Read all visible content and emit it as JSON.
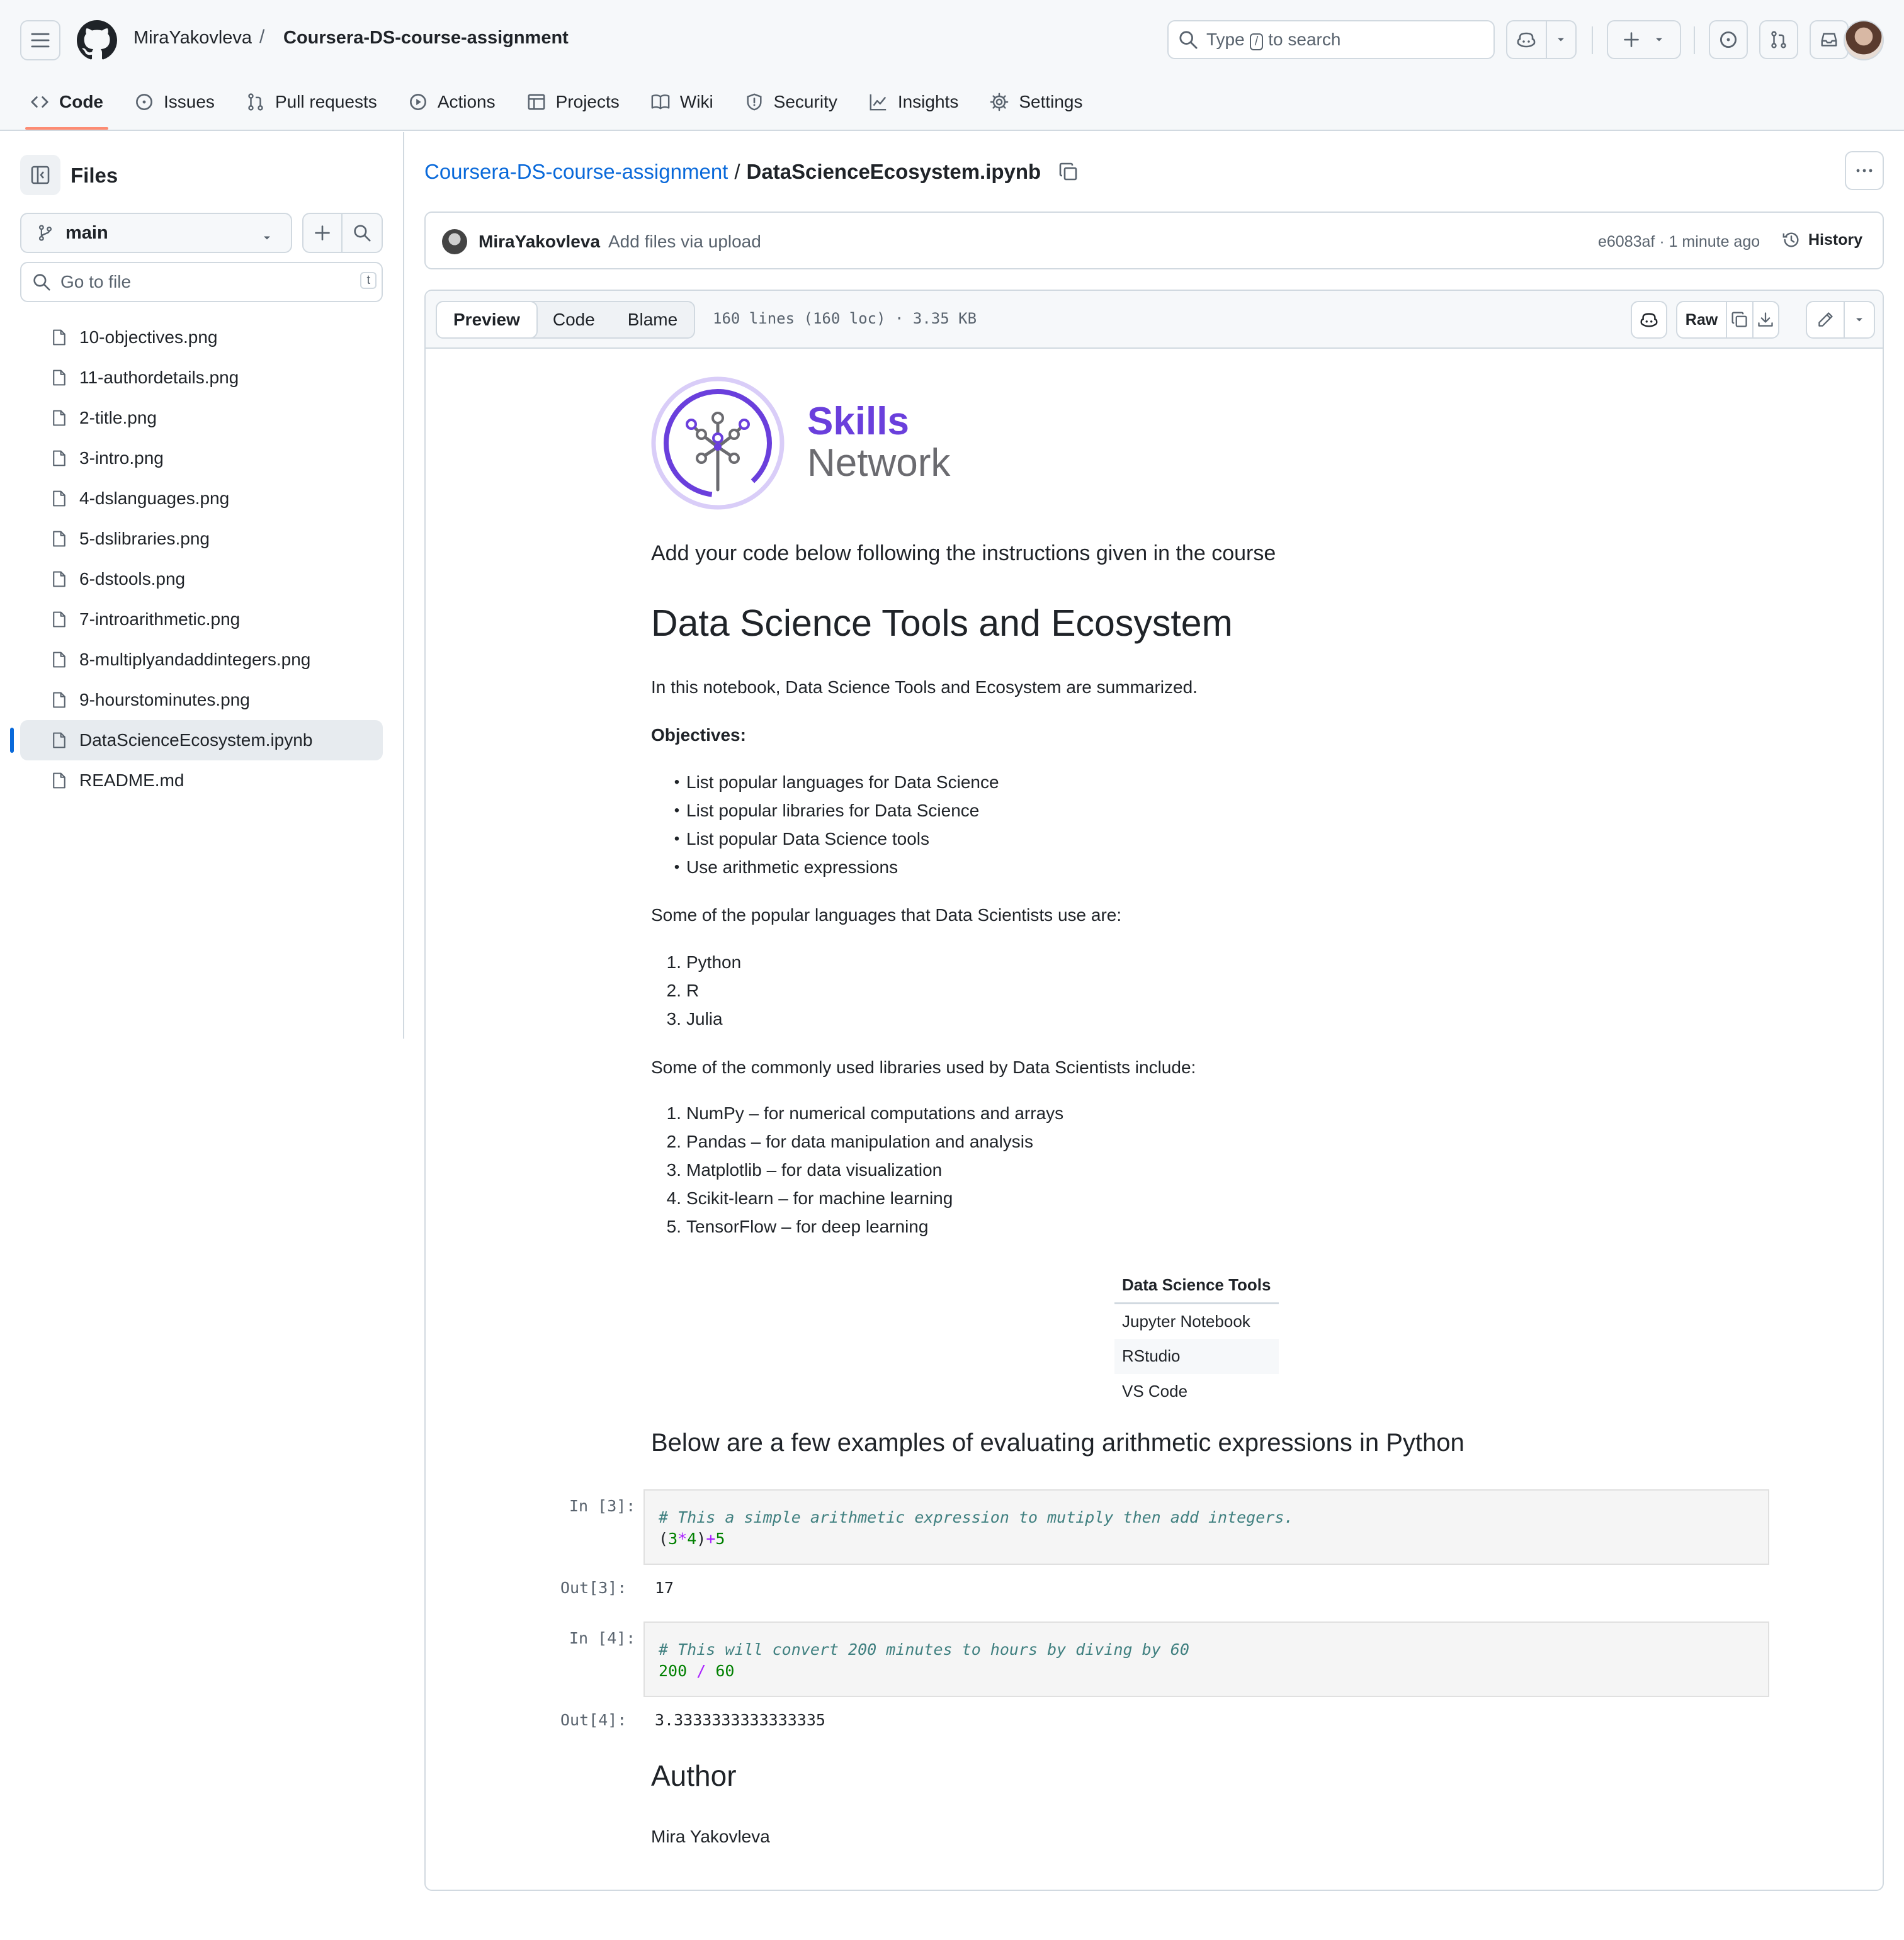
{
  "header": {
    "owner": "MiraYakovleva",
    "separator": "/",
    "repo": "Coursera-DS-course-assignment",
    "search_prefix": "Type",
    "search_key": "/",
    "search_suffix": "to search"
  },
  "repo_nav": [
    {
      "label": "Code",
      "icon": "code-icon",
      "active": true
    },
    {
      "label": "Issues",
      "icon": "issue-icon"
    },
    {
      "label": "Pull requests",
      "icon": "pull-request-icon"
    },
    {
      "label": "Actions",
      "icon": "play-icon"
    },
    {
      "label": "Projects",
      "icon": "table-icon"
    },
    {
      "label": "Wiki",
      "icon": "book-icon"
    },
    {
      "label": "Security",
      "icon": "shield-icon"
    },
    {
      "label": "Insights",
      "icon": "graph-icon"
    },
    {
      "label": "Settings",
      "icon": "gear-icon"
    }
  ],
  "sidebar": {
    "title": "Files",
    "branch": "main",
    "goto_placeholder": "Go to file",
    "goto_key": "t",
    "files": [
      "10-objectives.png",
      "11-authordetails.png",
      "2-title.png",
      "3-intro.png",
      "4-dslanguages.png",
      "5-dslibraries.png",
      "6-dstools.png",
      "7-introarithmetic.png",
      "8-multiplyandaddintegers.png",
      "9-hourstominutes.png",
      "DataScienceEcosystem.ipynb",
      "README.md"
    ],
    "selected_file": "DataScienceEcosystem.ipynb"
  },
  "main": {
    "breadcrumb_repo": "Coursera-DS-course-assignment",
    "breadcrumb_sep": "/",
    "breadcrumb_file": "DataScienceEcosystem.ipynb",
    "commit": {
      "author": "MiraYakovleva",
      "message": "Add files via upload",
      "meta": "e6083af · 1 minute ago",
      "history_label": "History"
    },
    "tabs": [
      "Preview",
      "Code",
      "Blame"
    ],
    "active_tab": "Preview",
    "file_stats": "160 lines (160 loc) · 3.35 KB",
    "raw_label": "Raw"
  },
  "notebook": {
    "logo_line1": "Skills",
    "logo_line2": "Network",
    "intro": "Add your code below following the instructions given in the course",
    "title": "Data Science Tools and Ecosystem",
    "summary": "In this notebook, Data Science Tools and Ecosystem are summarized.",
    "objectives_label": "Objectives:",
    "objectives": [
      "List popular languages for Data Science",
      "List popular libraries for Data Science",
      "List popular Data Science tools",
      "Use arithmetic expressions"
    ],
    "languages_intro": "Some of the popular languages that Data Scientists use are:",
    "languages": [
      "Python",
      "R",
      "Julia"
    ],
    "libraries_intro": "Some of the commonly used libraries used by Data Scientists include:",
    "libraries": [
      "NumPy – for numerical computations and arrays",
      "Pandas – for data manipulation and analysis",
      "Matplotlib – for data visualization",
      "Scikit-learn – for machine learning",
      "TensorFlow – for deep learning"
    ],
    "tools_table": {
      "header": "Data Science Tools",
      "rows": [
        "Jupyter Notebook",
        "RStudio",
        "VS Code"
      ]
    },
    "arithmetic_heading": "Below are a few examples of evaluating arithmetic expressions in Python",
    "cell1": {
      "in_prompt": "In [3]:",
      "comment": "# This a simple arithmetic expression to mutiply then add integers.",
      "code_parts": [
        "(",
        "3",
        "*",
        "4",
        ")",
        "+",
        "5"
      ],
      "out_prompt": "Out[3]:",
      "output": "17"
    },
    "cell2": {
      "in_prompt": "In [4]:",
      "comment": "# This will convert 200 minutes to hours by diving by 60",
      "code_parts": [
        "200",
        " / ",
        "60"
      ],
      "out_prompt": "Out[4]:",
      "output": "3.3333333333333335"
    },
    "author_heading": "Author",
    "author_name": "Mira Yakovleva"
  },
  "colors": {
    "accent_blue": "#0969da",
    "nav_underline": "#fd8c73",
    "skills_purple": "#6a3fdc"
  }
}
